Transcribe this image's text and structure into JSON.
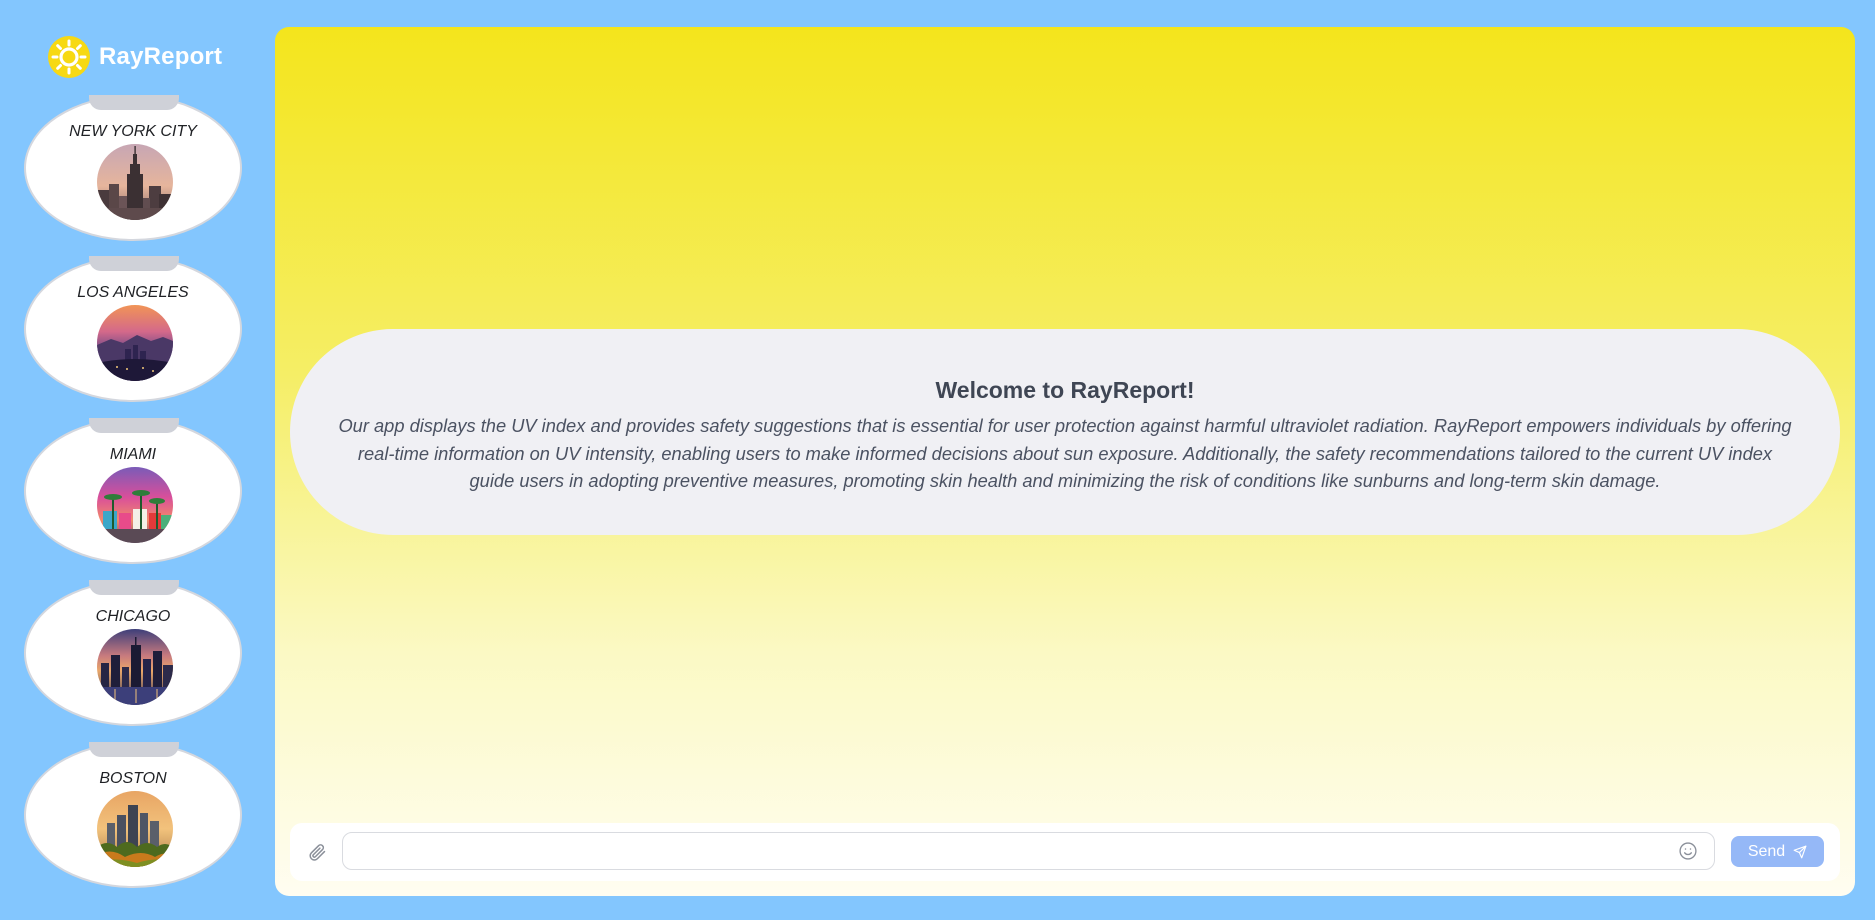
{
  "app": {
    "name": "RayReport",
    "logo_icon": "sun-icon"
  },
  "cities": [
    {
      "name": "NEW YORK CITY",
      "photo": "new-york-skyline"
    },
    {
      "name": "LOS ANGELES",
      "photo": "los-angeles-skyline"
    },
    {
      "name": "MIAMI",
      "photo": "miami-beach-skyline"
    },
    {
      "name": "CHICAGO",
      "photo": "chicago-skyline"
    },
    {
      "name": "BOSTON",
      "photo": "boston-skyline"
    }
  ],
  "welcome": {
    "title": "Welcome to RayReport!",
    "body": "Our app displays the UV index and provides safety suggestions that is essential for user protection against harmful ultraviolet radiation. RayReport empowers individuals by offering real-time information on UV intensity, enabling users to make informed decisions about sun exposure. Additionally, the safety recommendations tailored to the current UV index guide users in adopting preventive measures, promoting skin health and minimizing the risk of conditions like sunburns and long-term skin damage."
  },
  "composer": {
    "placeholder": "",
    "value": "",
    "send_label": "Send",
    "attach_icon": "paperclip-icon",
    "emoji_icon": "smiley-icon",
    "send_icon": "paper-plane-icon"
  },
  "colors": {
    "background": "#83c6fe",
    "gradient_top": "#f4e51c",
    "gradient_bottom": "#fffdf1",
    "welcome_bubble": "#f0f0f4",
    "send_button": "#95b8f7",
    "card_tab": "#cfd1d8"
  }
}
